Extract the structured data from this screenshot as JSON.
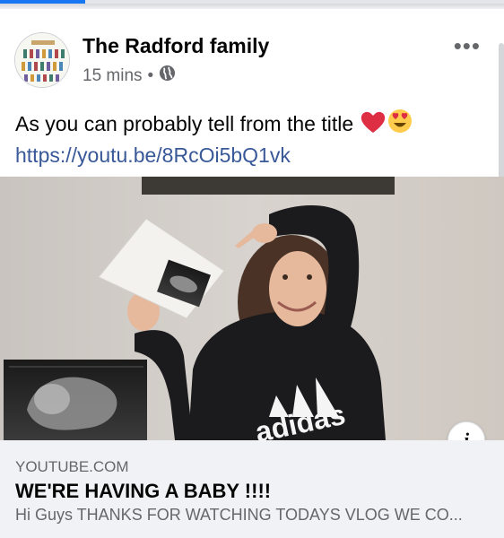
{
  "post": {
    "author": "The Radford family",
    "time": "15 mins",
    "separator": "•",
    "audience_icon": "globe-icon",
    "more_icon": "more-options-icon",
    "text_line1": "As you can probably tell from the title",
    "emojis": [
      "red-heart-emoji",
      "heart-eyes-emoji"
    ],
    "link": "https://youtu.be/8RcOi5bQ1vk"
  },
  "media": {
    "hoodie_text": "adidas",
    "info_label": "i"
  },
  "link_preview": {
    "domain": "YOUTUBE.COM",
    "title": "WE'RE HAVING A BABY !!!!",
    "description": "Hi Guys THANKS FOR WATCHING TODAYS VLOG WE CO..."
  },
  "colors": {
    "link": "#385898",
    "secondary_text": "#65676b",
    "card_bg": "#f0f2f5",
    "progress": "#1877f2"
  }
}
